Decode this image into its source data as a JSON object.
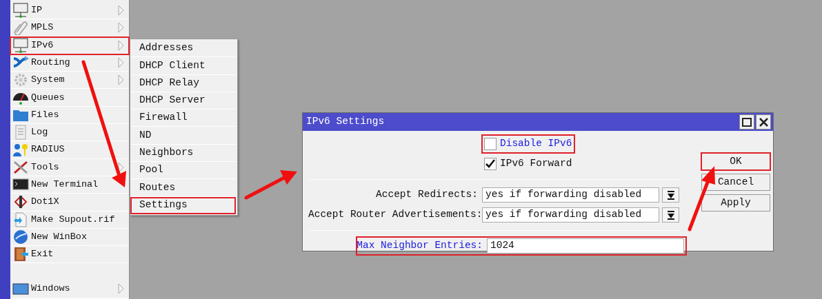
{
  "menu": {
    "items": [
      {
        "label": "IP",
        "submenu": true,
        "highlighted": false
      },
      {
        "label": "MPLS",
        "submenu": true,
        "highlighted": false
      },
      {
        "label": "IPv6",
        "submenu": true,
        "highlighted": true
      },
      {
        "label": "Routing",
        "submenu": true,
        "highlighted": false
      },
      {
        "label": "System",
        "submenu": true,
        "highlighted": false
      },
      {
        "label": "Queues",
        "submenu": false,
        "highlighted": false
      },
      {
        "label": "Files",
        "submenu": false,
        "highlighted": false
      },
      {
        "label": "Log",
        "submenu": false,
        "highlighted": false
      },
      {
        "label": "RADIUS",
        "submenu": false,
        "highlighted": false
      },
      {
        "label": "Tools",
        "submenu": true,
        "highlighted": false
      },
      {
        "label": "New Terminal",
        "submenu": false,
        "highlighted": false
      },
      {
        "label": "Dot1X",
        "submenu": false,
        "highlighted": false
      },
      {
        "label": "Make Supout.rif",
        "submenu": false,
        "highlighted": false
      },
      {
        "label": "New WinBox",
        "submenu": false,
        "highlighted": false
      },
      {
        "label": "Exit",
        "submenu": false,
        "highlighted": false
      },
      {
        "label": "Windows",
        "submenu": true,
        "highlighted": false
      }
    ]
  },
  "submenu": {
    "items": [
      {
        "label": "Addresses",
        "highlighted": false
      },
      {
        "label": "DHCP Client",
        "highlighted": false
      },
      {
        "label": "DHCP Relay",
        "highlighted": false
      },
      {
        "label": "DHCP Server",
        "highlighted": false
      },
      {
        "label": "Firewall",
        "highlighted": false
      },
      {
        "label": "ND",
        "highlighted": false
      },
      {
        "label": "Neighbors",
        "highlighted": false
      },
      {
        "label": "Pool",
        "highlighted": false
      },
      {
        "label": "Routes",
        "highlighted": false
      },
      {
        "label": "Settings",
        "highlighted": true
      }
    ]
  },
  "dialog": {
    "title": "IPv6 Settings",
    "controls": [
      {
        "kind": "checkbox",
        "label": "Disable IPv6",
        "checked": false,
        "modified": true,
        "highlighted": true
      },
      {
        "kind": "checkbox",
        "label": "IPv6 Forward",
        "checked": true,
        "modified": false,
        "highlighted": false
      },
      {
        "kind": "separator"
      },
      {
        "kind": "select",
        "label": "Accept Redirects:",
        "value": "yes if forwarding disabled",
        "modified": false,
        "highlighted": false
      },
      {
        "kind": "select",
        "label": "Accept Router Advertisements:",
        "value": "yes if forwarding disabled",
        "modified": false,
        "highlighted": false
      },
      {
        "kind": "separator"
      },
      {
        "kind": "field",
        "label": "Max Neighbor Entries:",
        "value": "1024",
        "modified": true,
        "highlighted": true
      }
    ],
    "buttons": [
      {
        "label": "OK",
        "highlighted": true
      },
      {
        "label": "Cancel",
        "highlighted": false
      },
      {
        "label": "Apply",
        "highlighted": false
      }
    ]
  }
}
